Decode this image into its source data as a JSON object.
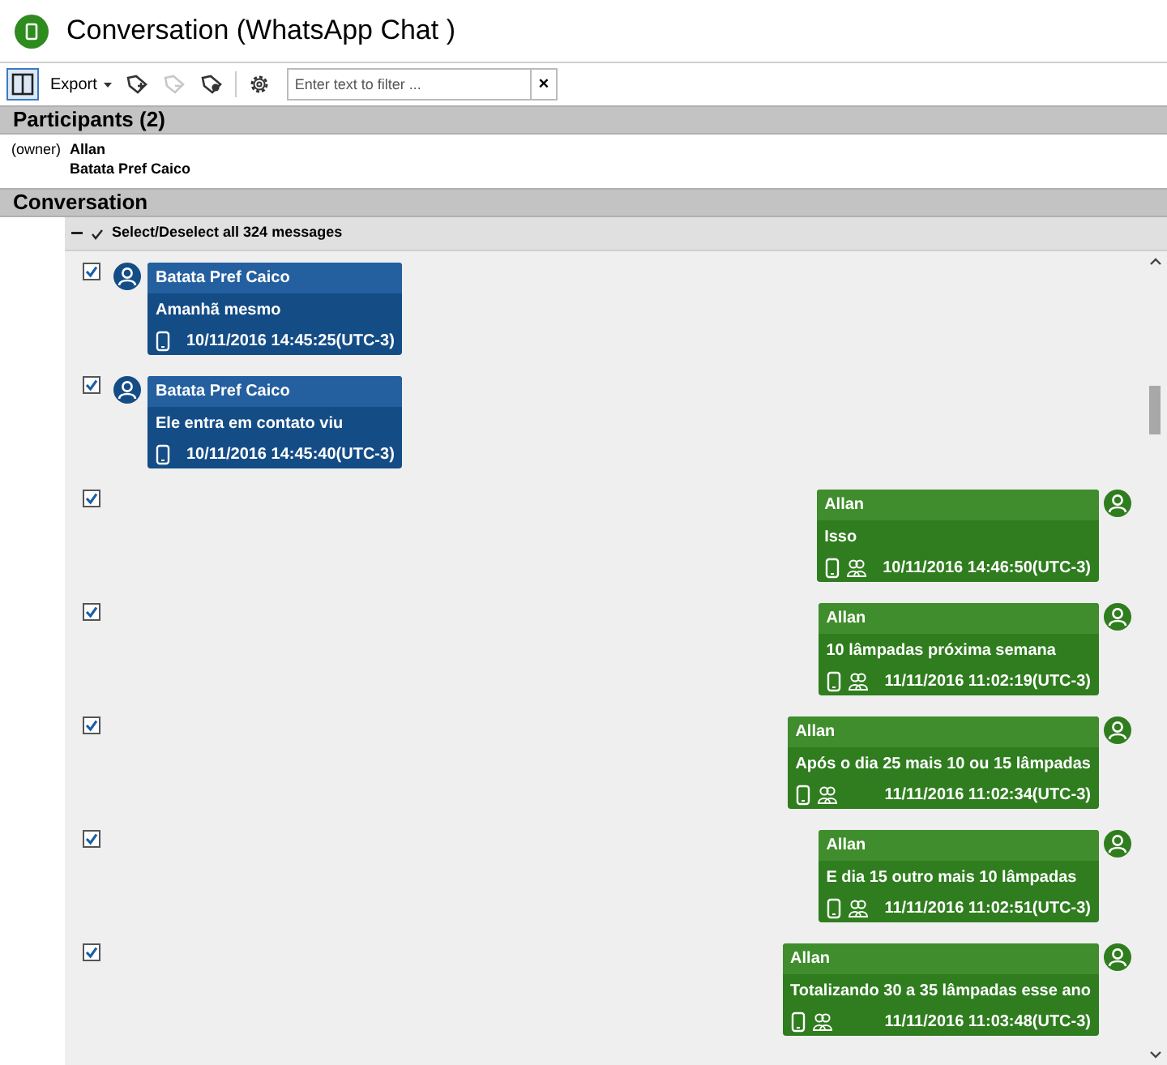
{
  "window": {
    "title": "Conversation (WhatsApp Chat )"
  },
  "toolbar": {
    "layout_toggle": {
      "selected": true
    },
    "export": "Export",
    "tools": [
      {
        "kind": "add",
        "disabled": false
      },
      {
        "kind": "remove",
        "disabled": true
      },
      {
        "kind": "tag",
        "disabled": false
      }
    ],
    "filter": {
      "placeholder": "Enter text to filter ...",
      "clear": "×"
    }
  },
  "participants": {
    "title": "Participants (2)",
    "items": [
      {
        "role": "(owner)",
        "name": "Allan"
      },
      {
        "name": "Batata Pref Caico"
      }
    ]
  },
  "conversation": {
    "title": "Conversation",
    "select_all": {
      "checked": true,
      "label": "Select/Deselect all 324 messages"
    },
    "messages": [
      {
        "kind": "incoming",
        "checked": true,
        "sender": "Batata Pref Caico",
        "text": "Amanhã mesmo",
        "time": "10/11/2016 14:45:25(UTC-3)"
      },
      {
        "kind": "incoming",
        "checked": true,
        "sender": "Batata Pref Caico",
        "text": "Ele entra em contato viu",
        "time": "10/11/2016 14:45:40(UTC-3)"
      },
      {
        "kind": "outgoing",
        "checked": true,
        "sender": "Allan",
        "text": "Isso",
        "time": "10/11/2016 14:46:50(UTC-3)"
      },
      {
        "kind": "outgoing",
        "checked": true,
        "sender": "Allan",
        "text": "10 lâmpadas próxima semana",
        "time": "11/11/2016 11:02:19(UTC-3)"
      },
      {
        "kind": "outgoing",
        "checked": true,
        "sender": "Allan",
        "text": "Após o dia 25 mais 10 ou 15 lâmpadas",
        "time": "11/11/2016 11:02:34(UTC-3)"
      },
      {
        "kind": "outgoing",
        "checked": true,
        "sender": "Allan",
        "text": "E dia 15 outro mais 10 lâmpadas",
        "time": "11/11/2016 11:02:51(UTC-3)"
      },
      {
        "kind": "outgoing",
        "checked": true,
        "sender": "Allan",
        "text": "Totalizando 30 a 35 lâmpadas esse ano",
        "time": "11/11/2016 11:03:48(UTC-3)"
      }
    ]
  }
}
